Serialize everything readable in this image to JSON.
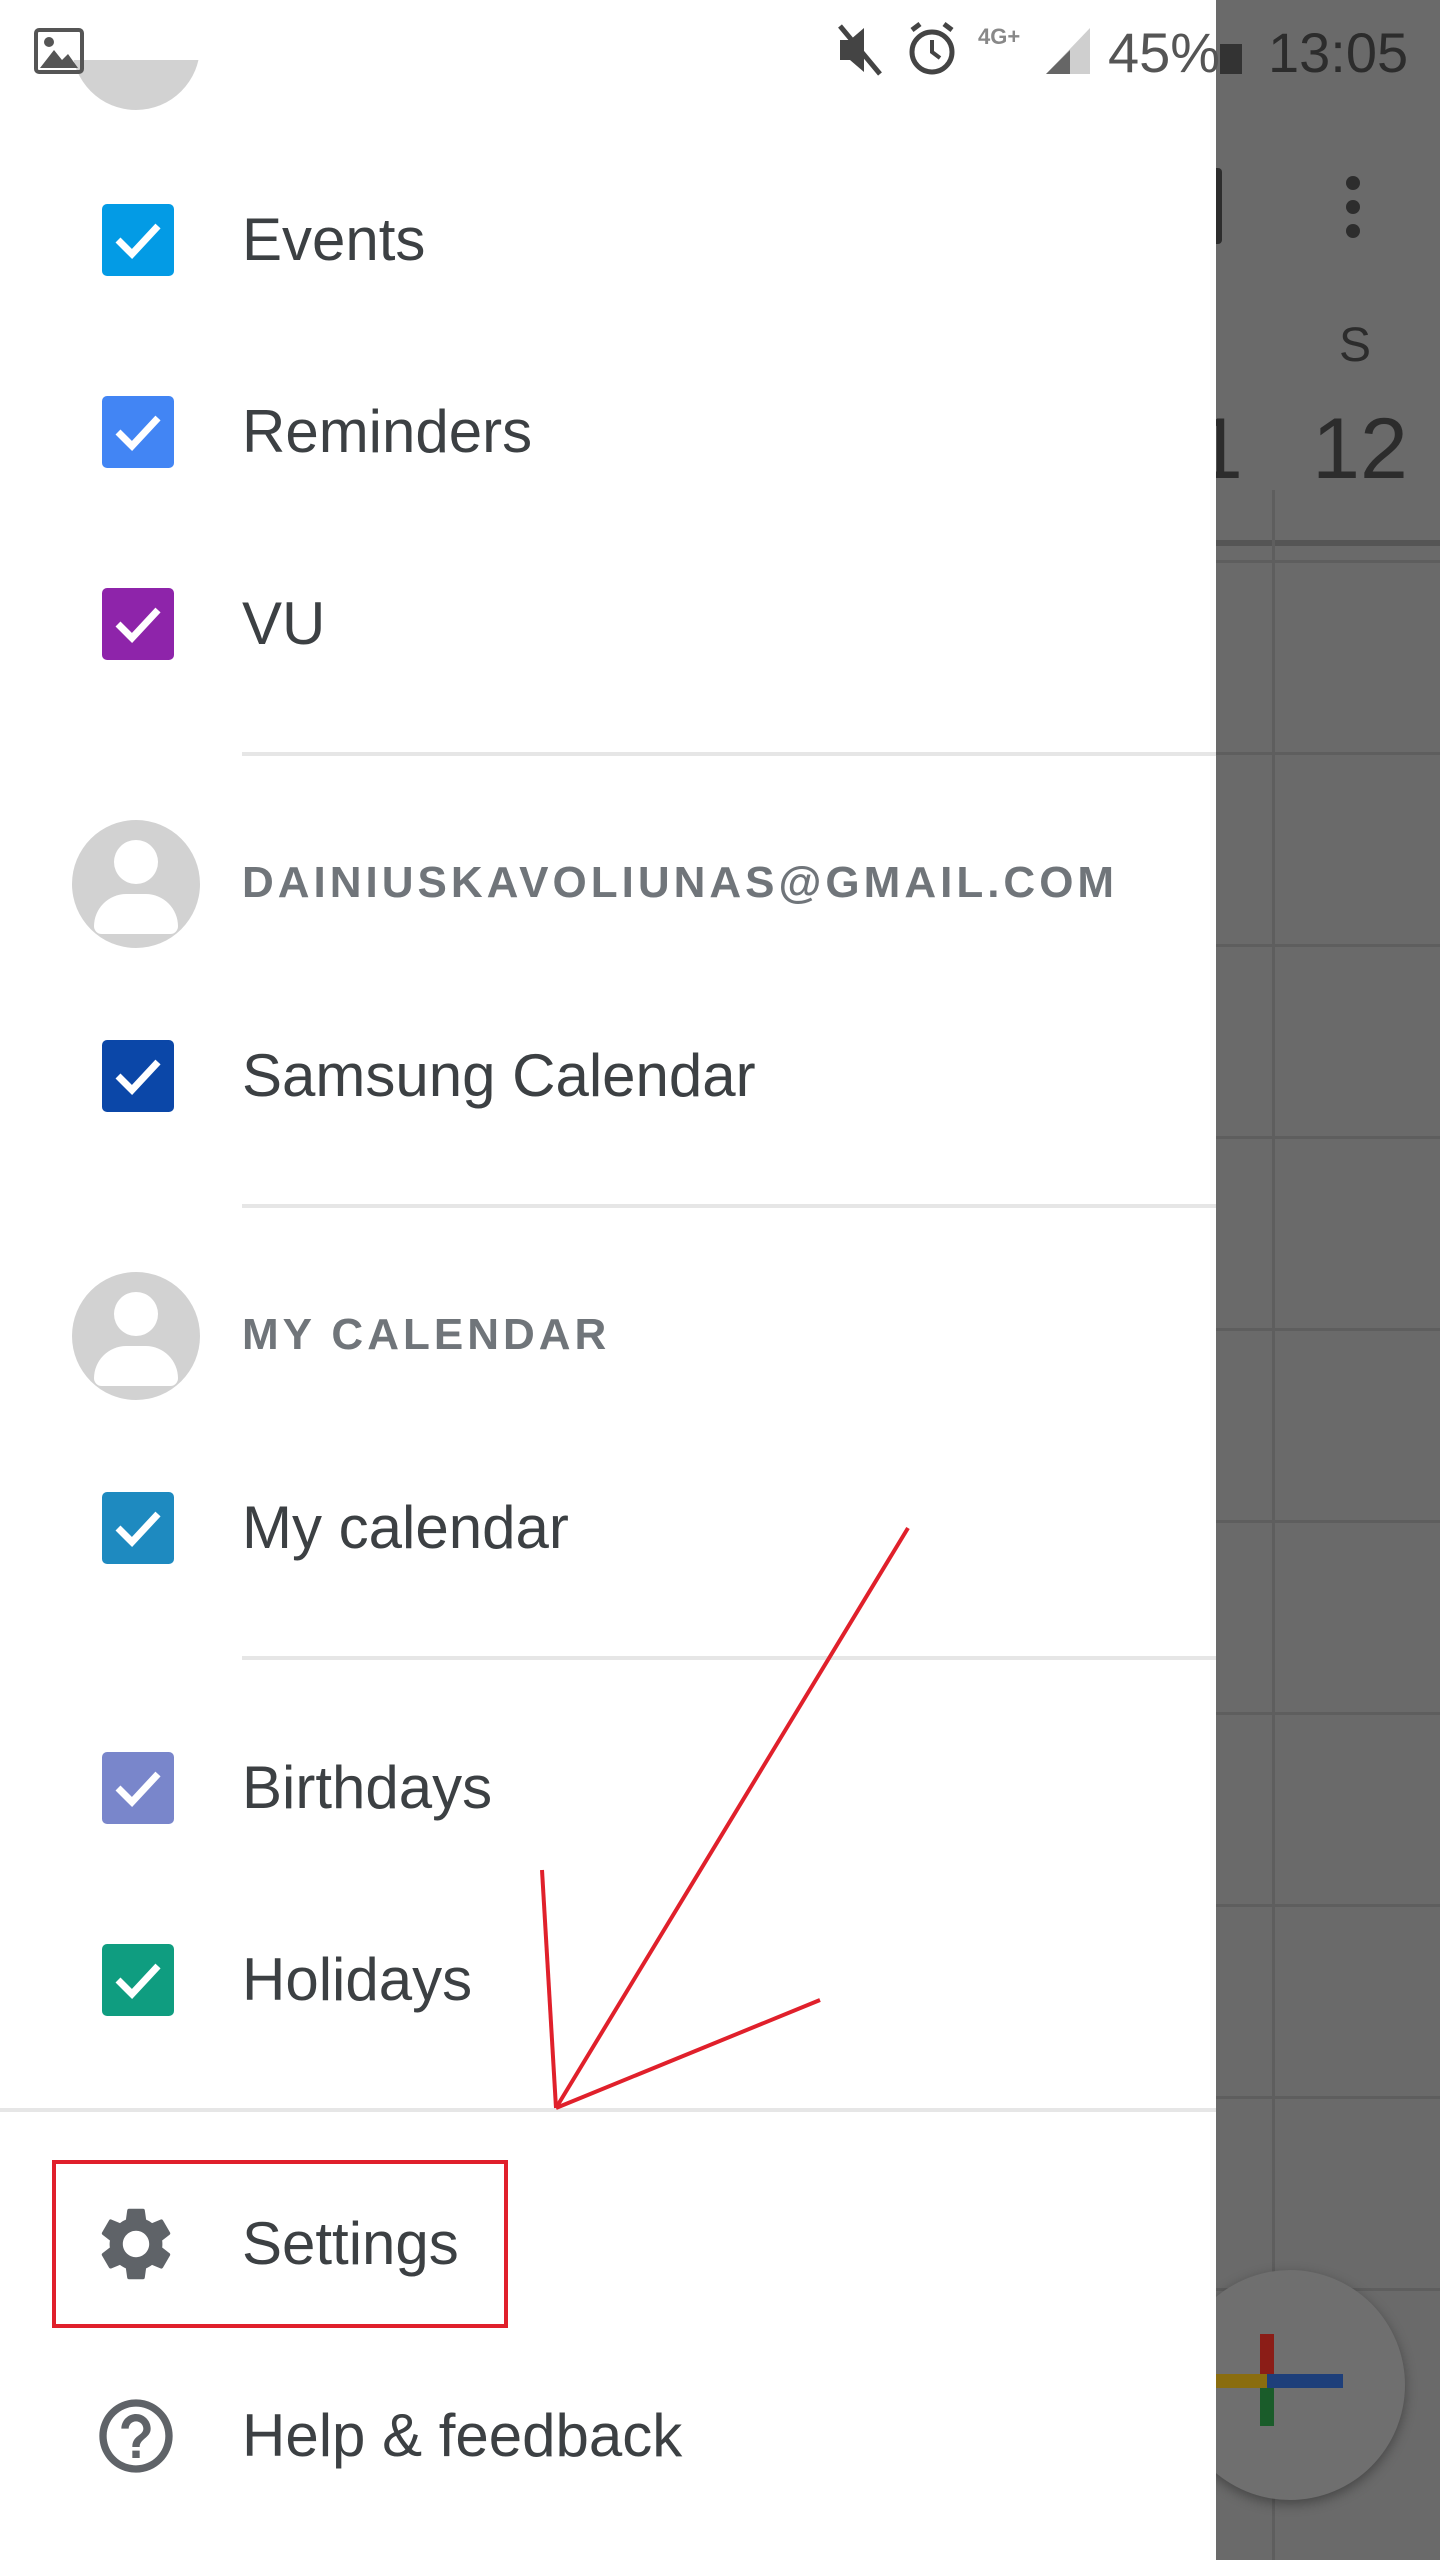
{
  "status_bar": {
    "battery": "45%",
    "time": "13:05",
    "network": "4G+"
  },
  "calendars_top": [
    {
      "label": "Events",
      "color": "#039be5"
    },
    {
      "label": "Reminders",
      "color": "#4285f4"
    },
    {
      "label": "VU",
      "color": "#8e24aa"
    }
  ],
  "account_gmail": {
    "label": "DAINIUSKAVOLIUNAS@GMAIL.COM",
    "calendars": [
      {
        "label": "Samsung Calendar",
        "color": "#0b47a8"
      }
    ]
  },
  "account_my": {
    "label": "MY CALENDAR",
    "calendars": [
      {
        "label": "My calendar",
        "color": "#1e8ac0"
      }
    ]
  },
  "calendars_other": [
    {
      "label": "Birthdays",
      "color": "#7986cb"
    },
    {
      "label": "Holidays",
      "color": "#0f9d80"
    }
  ],
  "menu": {
    "settings": "Settings",
    "help": "Help & feedback"
  },
  "background": {
    "day_letter": "S",
    "day_number": "12",
    "partial_day": "1"
  },
  "annotation": {
    "color": "#e0202b"
  }
}
